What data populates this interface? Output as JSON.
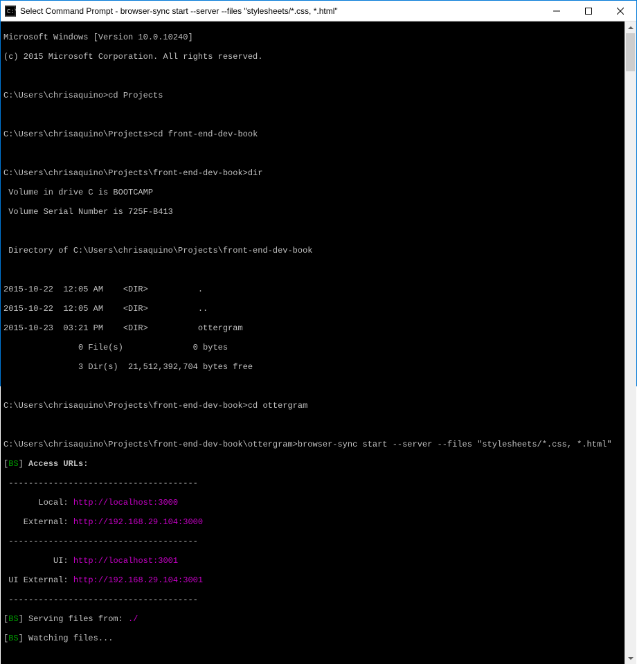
{
  "titlebar": {
    "title": "Select Command Prompt - browser-sync  start --server --files \"stylesheets/*.css, *.html\""
  },
  "terminal": {
    "line1": "Microsoft Windows [Version 10.0.10240]",
    "line2": "(c) 2015 Microsoft Corporation. All rights reserved.",
    "line3": "",
    "prompt1": "C:\\Users\\chrisaquino>",
    "cmd1": "cd Projects",
    "line5": "",
    "prompt2": "C:\\Users\\chrisaquino\\Projects>",
    "cmd2": "cd front-end-dev-book",
    "line7": "",
    "prompt3": "C:\\Users\\chrisaquino\\Projects\\front-end-dev-book>",
    "cmd3": "dir",
    "dir1": " Volume in drive C is BOOTCAMP",
    "dir2": " Volume Serial Number is 725F-B413",
    "dir3": "",
    "dir4": " Directory of C:\\Users\\chrisaquino\\Projects\\front-end-dev-book",
    "dir5": "",
    "dir6": "2015-10-22  12:05 AM    <DIR>          .",
    "dir7": "2015-10-22  12:05 AM    <DIR>          ..",
    "dir8": "2015-10-23  03:21 PM    <DIR>          ottergram",
    "dir9": "               0 File(s)              0 bytes",
    "dir10": "               3 Dir(s)  21,512,392,704 bytes free",
    "line18": "",
    "prompt4": "C:\\Users\\chrisaquino\\Projects\\front-end-dev-book>",
    "cmd4": "cd ottergram",
    "line20": "",
    "prompt5": "C:\\Users\\chrisaquino\\Projects\\front-end-dev-book\\ottergram>",
    "cmd5": "browser-sync start --server --files \"stylesheets/*.css, *.html\"",
    "bs_bracket_l": "[",
    "bs_tag": "BS",
    "bs_bracket_r": "]",
    "bs_access_label": " Access URLs:",
    "bs_divider": " --------------------------------------",
    "bs_local_label": "       Local: ",
    "bs_local_url": "http://localhost:3000",
    "bs_external_label": "    External: ",
    "bs_external_url": "http://192.168.29.104:3000",
    "bs_ui_label": "          UI: ",
    "bs_ui_url": "http://localhost:3001",
    "bs_uiext_label": " UI External: ",
    "bs_uiext_url": "http://192.168.29.104:3001",
    "bs_serving": " Serving files from: ",
    "bs_serving_path": "./",
    "bs_watching": " Watching files..."
  }
}
